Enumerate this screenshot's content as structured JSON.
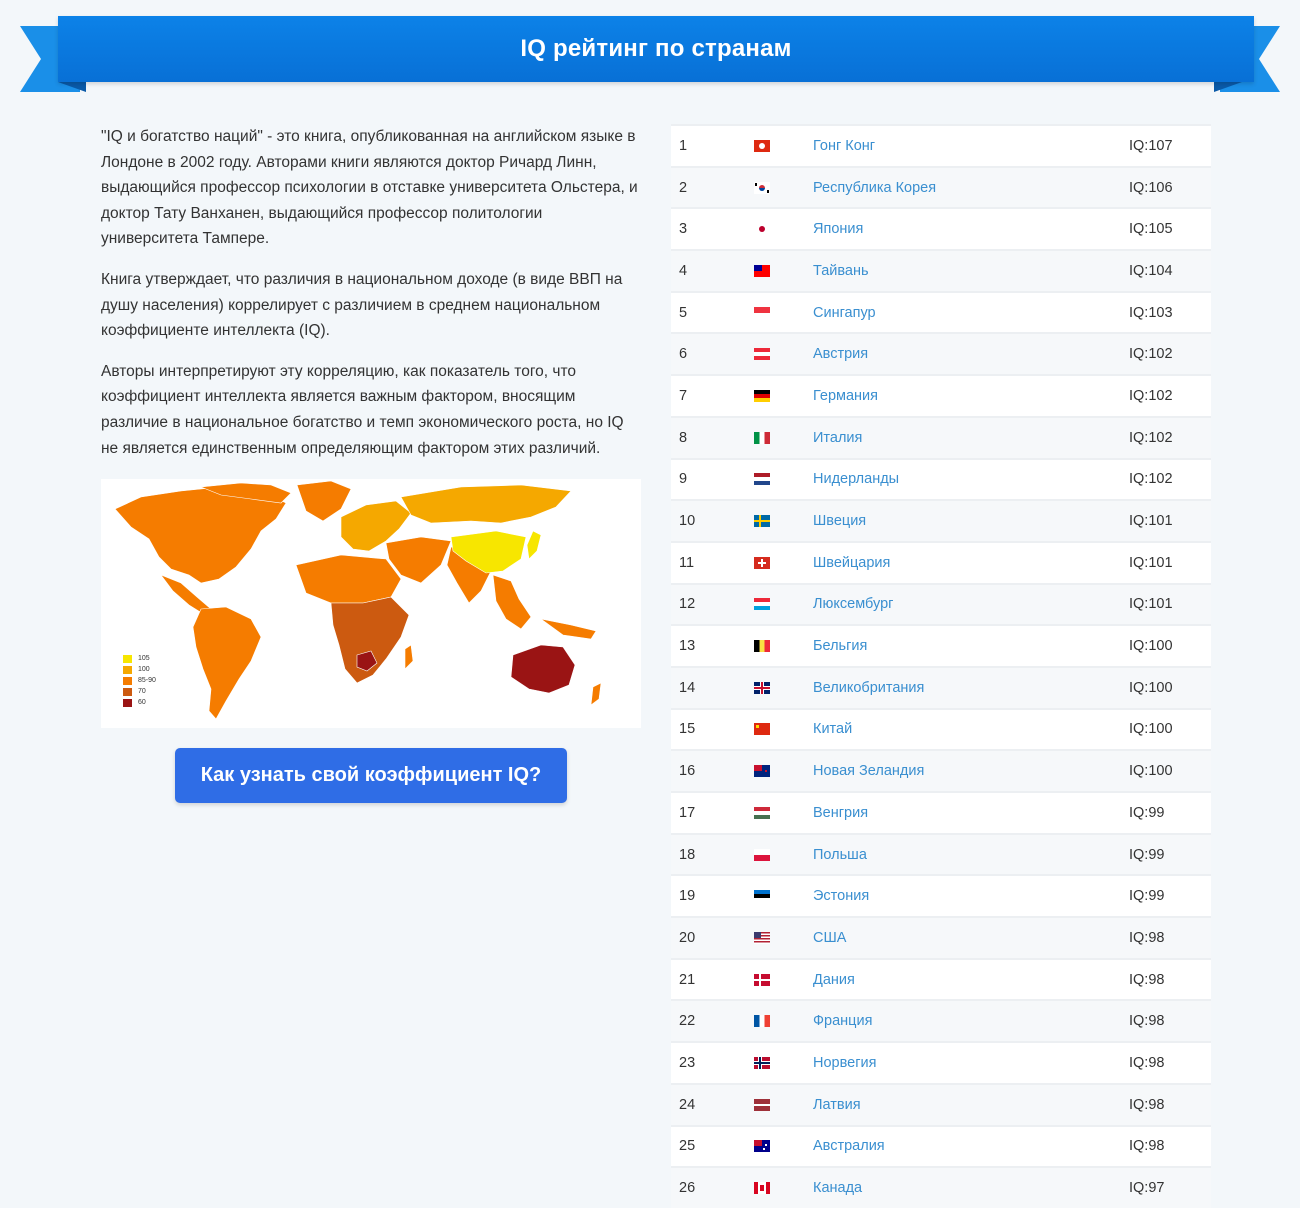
{
  "header": {
    "title": "IQ рейтинг по странам"
  },
  "intro": {
    "paragraphs": [
      "\"IQ и богатство наций\" - это книга, опубликованная на английском языке в Лондоне в 2002 году. Авторами книги являются доктор Ричард Линн, выдающийся профессор психологии в отставке университета Ольстера, и доктор Тату Ванханен, выдающийся профессор политологии университета Тампере.",
      "Книга утверждает, что различия в национальном доходе (в виде ВВП на душу населения) коррелирует с различием в среднем национальном коэффициенте интеллекта (IQ).",
      "Авторы интерпретируют эту корреляцию, как показатель того, что коэффициент интеллекта является важным фактором, вносящим различие в национальное богатство и темп экономического роста, но IQ не является единственным определяющим фактором этих различий."
    ]
  },
  "map": {
    "legend": [
      {
        "label": "105",
        "color": "#f7e600"
      },
      {
        "label": "100",
        "color": "#f5a800"
      },
      {
        "label": "85-90",
        "color": "#f57c00"
      },
      {
        "label": "70",
        "color": "#cc5a10"
      },
      {
        "label": "60",
        "color": "#9a1414"
      }
    ]
  },
  "cta": {
    "label": "Как узнать свой коэффициент IQ?"
  },
  "rows": [
    {
      "rank": "1",
      "flag": "hk-flag-icon",
      "name": "Гонг Конг",
      "iq": "IQ:107"
    },
    {
      "rank": "2",
      "flag": "kr-flag-icon",
      "name": "Республика Корея",
      "iq": "IQ:106"
    },
    {
      "rank": "3",
      "flag": "jp-flag-icon",
      "name": "Япония",
      "iq": "IQ:105"
    },
    {
      "rank": "4",
      "flag": "tw-flag-icon",
      "name": "Тайвань",
      "iq": "IQ:104"
    },
    {
      "rank": "5",
      "flag": "sg-flag-icon",
      "name": "Сингапур",
      "iq": "IQ:103"
    },
    {
      "rank": "6",
      "flag": "at-flag-icon",
      "name": "Австрия",
      "iq": "IQ:102"
    },
    {
      "rank": "7",
      "flag": "de-flag-icon",
      "name": "Германия",
      "iq": "IQ:102"
    },
    {
      "rank": "8",
      "flag": "it-flag-icon",
      "name": "Италия",
      "iq": "IQ:102"
    },
    {
      "rank": "9",
      "flag": "nl-flag-icon",
      "name": "Нидерланды",
      "iq": "IQ:102"
    },
    {
      "rank": "10",
      "flag": "se-flag-icon",
      "name": "Швеция",
      "iq": "IQ:101"
    },
    {
      "rank": "11",
      "flag": "ch-flag-icon",
      "name": "Швейцария",
      "iq": "IQ:101"
    },
    {
      "rank": "12",
      "flag": "lu-flag-icon",
      "name": "Люксембург",
      "iq": "IQ:101"
    },
    {
      "rank": "13",
      "flag": "be-flag-icon",
      "name": "Бельгия",
      "iq": "IQ:100"
    },
    {
      "rank": "14",
      "flag": "gb-flag-icon",
      "name": "Великобритания",
      "iq": "IQ:100"
    },
    {
      "rank": "15",
      "flag": "cn-flag-icon",
      "name": "Китай",
      "iq": "IQ:100"
    },
    {
      "rank": "16",
      "flag": "nz-flag-icon",
      "name": "Новая Зеландия",
      "iq": "IQ:100"
    },
    {
      "rank": "17",
      "flag": "hu-flag-icon",
      "name": "Венгрия",
      "iq": "IQ:99"
    },
    {
      "rank": "18",
      "flag": "pl-flag-icon",
      "name": "Польша",
      "iq": "IQ:99"
    },
    {
      "rank": "19",
      "flag": "ee-flag-icon",
      "name": "Эстония",
      "iq": "IQ:99"
    },
    {
      "rank": "20",
      "flag": "us-flag-icon",
      "name": "США",
      "iq": "IQ:98"
    },
    {
      "rank": "21",
      "flag": "dk-flag-icon",
      "name": "Дания",
      "iq": "IQ:98"
    },
    {
      "rank": "22",
      "flag": "fr-flag-icon",
      "name": "Франция",
      "iq": "IQ:98"
    },
    {
      "rank": "23",
      "flag": "no-flag-icon",
      "name": "Норвегия",
      "iq": "IQ:98"
    },
    {
      "rank": "24",
      "flag": "lv-flag-icon",
      "name": "Латвия",
      "iq": "IQ:98"
    },
    {
      "rank": "25",
      "flag": "au-flag-icon",
      "name": "Австралия",
      "iq": "IQ:98"
    },
    {
      "rank": "26",
      "flag": "ca-flag-icon",
      "name": "Канада",
      "iq": "IQ:97"
    }
  ]
}
